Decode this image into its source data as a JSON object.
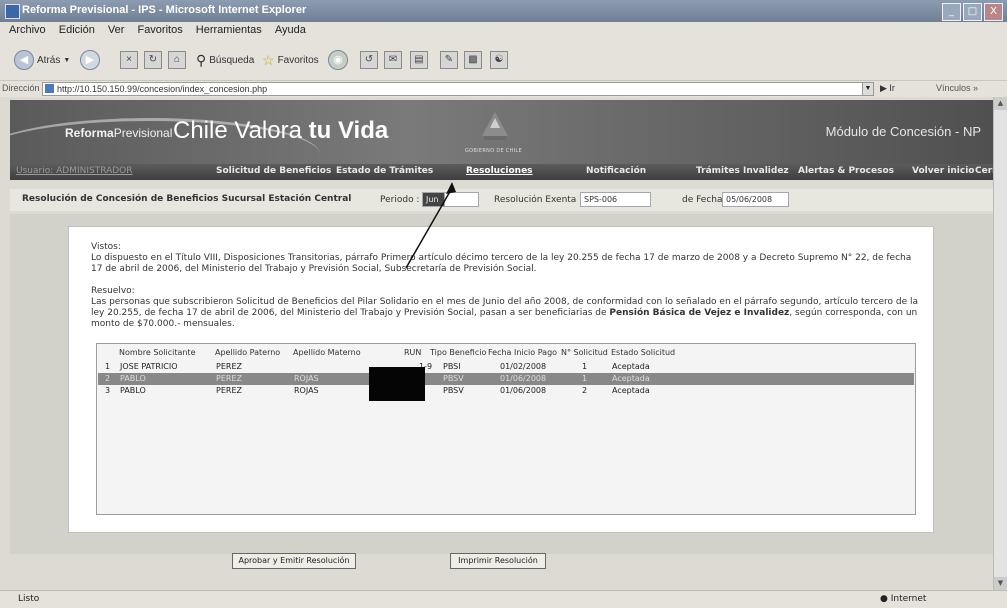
{
  "window": {
    "title": "Reforma Previsional - IPS - Microsoft Internet Explorer",
    "controls": [
      "_",
      "□",
      "X"
    ]
  },
  "menubar": [
    "Archivo",
    "Edición",
    "Ver",
    "Favoritos",
    "Herramientas",
    "Ayuda"
  ],
  "toolbar": {
    "back_label": "Atrás",
    "search_label": "Búsqueda",
    "favorites_label": "Favoritos"
  },
  "address": {
    "label": "Dirección",
    "url": "http://10.150.150.99/concesion/index_concesion.php",
    "go_label": "Ir",
    "links_label": "Vínculos"
  },
  "banner": {
    "brand_bold": "Reforma",
    "brand_rest": "Previsional",
    "tagline_plain": "Chile Valora ",
    "tagline_bold": "tu Vida",
    "gov_label": "GOBIERNO DE CHILE",
    "module": "Módulo de Concesión - NP"
  },
  "nav": {
    "user": "Usuario: ADMINISTRADOR",
    "items": [
      "Solicitud de Beneficios",
      "Estado de Trámites",
      "Resoluciones",
      "Notificación",
      "Trámites Invalidez",
      "Alertas & Procesos",
      "Volver inicio",
      "Cerrar"
    ]
  },
  "resolution_header": {
    "title": "Resolución de Concesión de Beneficios Sucursal Estación Central",
    "period_label": "Periodo :",
    "period_value": "Jun",
    "exenta_label": "Resolución Exenta N° :",
    "exenta_value": "SPS-006",
    "date_label": "de Fecha :",
    "date_value": "05/06/2008"
  },
  "body": {
    "vistos_heading": "Vistos:",
    "vistos_text": "Lo dispuesto en el Título VIII, Disposiciones Transitorias, párrafo Primero artículo décimo tercero de la ley 20.255 de fecha 17 de marzo de 2008 y a Decreto Supremo N° 22, de fecha 17 de abril de 2006, del Ministerio del Trabajo y Previsión Social, Subsecretaría de Previsión Social.",
    "resuelvo_heading": "Resuelvo:",
    "resuelvo_text_pre": "Las personas que subscribieron Solicitud de Beneficios del Pilar Solidario en el mes de Junio del año 2008, de conformidad con lo señalado en el párrafo segundo, artículo tercero de la ley 20.255, de fecha 17 de abril de 2006, del Ministerio del Trabajo y Previsión Social, pasan a ser beneficiarias de ",
    "resuelvo_text_bold": "Pensión Básica de Vejez e Invalidez",
    "resuelvo_text_post": ", según corresponda, con un monto de $70.000.- mensuales."
  },
  "table": {
    "headers": [
      "Nombre Solicitante",
      "Apellido Paterno",
      "Apellido Materno",
      "RUN",
      "Tipo Beneficio",
      "Fecha Inicio Pago",
      "N° Solicitud",
      "Estado Solicitud"
    ],
    "rows": [
      {
        "n": "1",
        "nombre": "JOSE PATRICIO",
        "paterno": "PEREZ",
        "materno": "",
        "run": "1-9",
        "tipo": "PBSI",
        "fecha": "01/02/2008",
        "solicitud": "1",
        "estado": "Aceptada"
      },
      {
        "n": "2",
        "nombre": "PABLO",
        "paterno": "PEREZ",
        "materno": "ROJAS",
        "run": "",
        "tipo": "PBSV",
        "fecha": "01/06/2008",
        "solicitud": "1",
        "estado": "Aceptada"
      },
      {
        "n": "3",
        "nombre": "PABLO",
        "paterno": "PEREZ",
        "materno": "ROJAS",
        "run": "",
        "tipo": "PBSV",
        "fecha": "01/06/2008",
        "solicitud": "2",
        "estado": "Aceptada"
      }
    ]
  },
  "buttons": {
    "approve": "Aprobar y Emitir Resolución",
    "print": "Imprimir Resolución"
  },
  "status": {
    "left": "Listo",
    "zone": "Internet"
  }
}
